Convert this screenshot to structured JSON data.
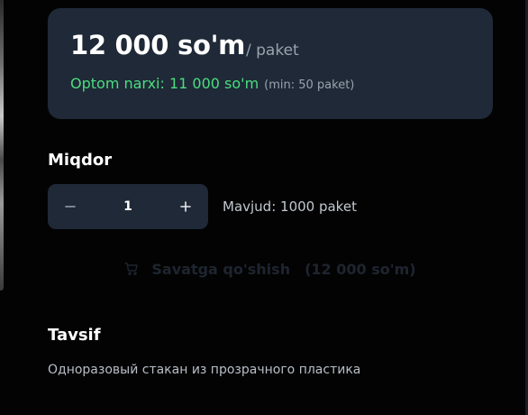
{
  "price_card": {
    "price": "12 000 so'm",
    "unit": "/ paket",
    "wholesale_label": "Optom narxi: 11 000 so'm",
    "wholesale_min": "(min: 50 paket)"
  },
  "quantity": {
    "title": "Miqdor",
    "value": "1",
    "minus_icon": "minus-icon",
    "plus_icon": "plus-icon",
    "stock": "Mavjud: 1000 paket"
  },
  "cart_button": {
    "icon": "cart-icon",
    "label": "Savatga qo'shish",
    "price": "(12 000 so'm)",
    "state": "disabled"
  },
  "description": {
    "title": "Tavsif",
    "text": "Одноразовый стакан из прозрачного пластика"
  },
  "colors": {
    "background": "#030303",
    "card": "#1f2937",
    "wholesale": "#4ade80",
    "muted": "#9aa3af"
  }
}
